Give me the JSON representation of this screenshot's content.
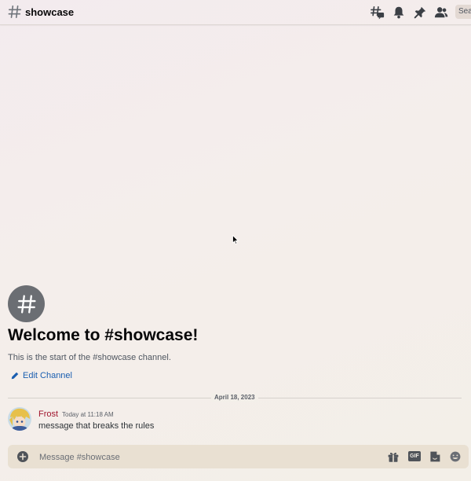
{
  "header": {
    "channel_name": "showcase",
    "search_placeholder": "Search",
    "icons": [
      "threads-icon",
      "bell-icon",
      "pin-icon",
      "members-icon"
    ]
  },
  "intro": {
    "title": "Welcome to #showcase!",
    "subtitle": "This is the start of the #showcase channel.",
    "edit_label": "Edit Channel"
  },
  "divider": {
    "date": "April 18, 2023"
  },
  "message": {
    "author": "Frost",
    "timestamp": "Today at 11:18 AM",
    "content": "message that breaks the rules",
    "author_color": "#a0142d"
  },
  "composer": {
    "placeholder": "Message #showcase",
    "gif_label": "GIF",
    "icons": [
      "add-icon",
      "gift-icon",
      "gif-icon",
      "sticker-icon",
      "emoji-icon"
    ]
  },
  "colors": {
    "link": "#1a5eb0",
    "intro_icon_bg": "#6b6e73",
    "composer_bg": "#e9e0d2"
  }
}
